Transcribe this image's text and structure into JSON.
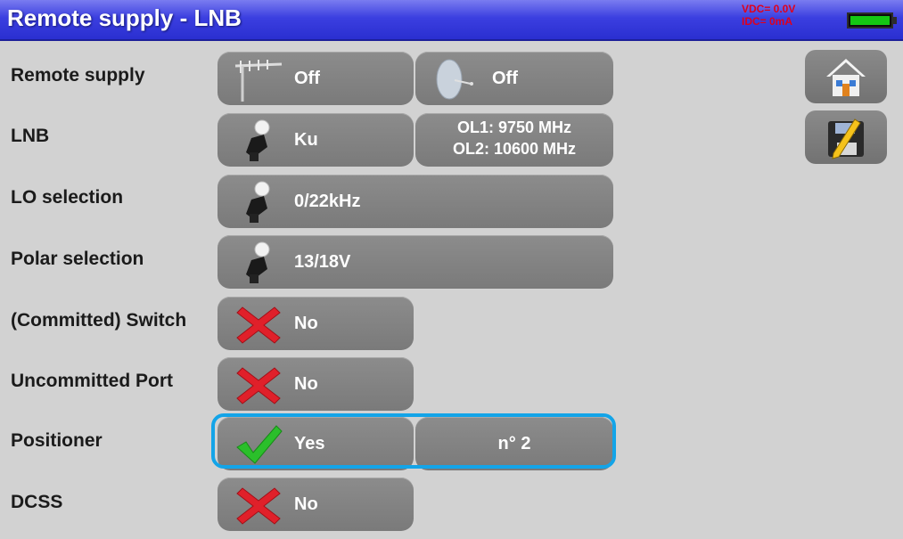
{
  "header": {
    "title": "Remote supply - LNB",
    "vdc": "VDC= 0.0V",
    "idc": "IDC= 0mA"
  },
  "rows": [
    {
      "label": "Remote supply",
      "buttons": [
        {
          "text": "Off",
          "icon": "antenna-icon"
        },
        {
          "text": "Off",
          "icon": "dish-icon"
        }
      ]
    },
    {
      "label": "LNB",
      "buttons": [
        {
          "text": "Ku",
          "icon": "lnb-icon"
        },
        {
          "line1": "OL1: 9750 MHz",
          "line2": "OL2: 10600 MHz"
        }
      ]
    },
    {
      "label": "LO selection",
      "buttons": [
        {
          "text": "0/22kHz",
          "icon": "lnb-icon"
        }
      ]
    },
    {
      "label": "Polar selection",
      "buttons": [
        {
          "text": "13/18V",
          "icon": "lnb-icon"
        }
      ]
    },
    {
      "label": "(Committed) Switch",
      "buttons": [
        {
          "text": "No",
          "icon": "red-x-icon"
        }
      ]
    },
    {
      "label": "Uncommitted Port",
      "buttons": [
        {
          "text": "No",
          "icon": "red-x-icon"
        }
      ]
    },
    {
      "label": "Positioner",
      "buttons": [
        {
          "text": "Yes",
          "icon": "green-check-icon"
        },
        {
          "text": "n° 2"
        }
      ]
    },
    {
      "label": "DCSS",
      "buttons": [
        {
          "text": "No",
          "icon": "red-x-icon"
        }
      ]
    }
  ],
  "side": [
    {
      "icon": "home-icon"
    },
    {
      "icon": "save-edit-icon"
    }
  ],
  "colors": {
    "title_bar": "#3b3fe0",
    "button": "#808080",
    "highlight": "#13a4e8",
    "status_text": "#e0001c",
    "battery": "#14c814"
  }
}
